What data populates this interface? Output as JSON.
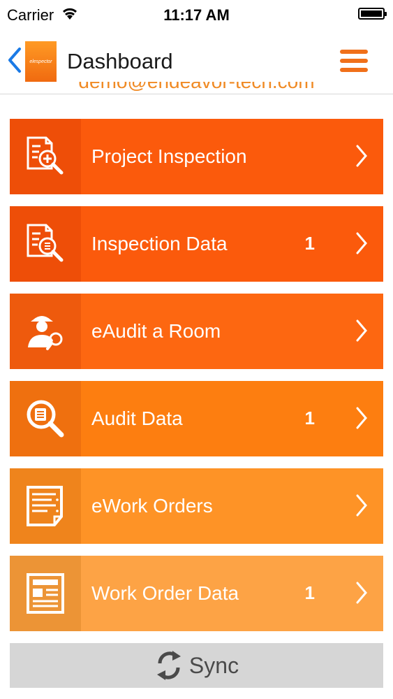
{
  "status_bar": {
    "carrier": "Carrier",
    "time": "11:17 AM"
  },
  "nav": {
    "title": "Dashboard",
    "logo_text": "elespector"
  },
  "account": {
    "email": "demo@endeavor-tech.com"
  },
  "menu": [
    {
      "label": "Project Inspection",
      "count": "",
      "icon": "inspection-add-icon",
      "label_bg": "#fb5a0c",
      "icon_bg": "#ee4e08"
    },
    {
      "label": "Inspection Data",
      "count": "1",
      "icon": "inspection-data-icon",
      "label_bg": "#fb5a0c",
      "icon_bg": "#ee4e08"
    },
    {
      "label": "eAudit a Room",
      "count": "",
      "icon": "auditor-icon",
      "label_bg": "#fd6711",
      "icon_bg": "#ee5a0d"
    },
    {
      "label": "Audit Data",
      "count": "1",
      "icon": "audit-data-icon",
      "label_bg": "#fd7e10",
      "icon_bg": "#ef700f"
    },
    {
      "label": "eWork Orders",
      "count": "",
      "icon": "work-orders-icon",
      "label_bg": "#fe9326",
      "icon_bg": "#ef841c"
    },
    {
      "label": "Work Order Data",
      "count": "1",
      "icon": "work-order-data-icon",
      "label_bg": "#fda345",
      "icon_bg": "#ec9436"
    }
  ],
  "sync": {
    "label": "Sync"
  }
}
